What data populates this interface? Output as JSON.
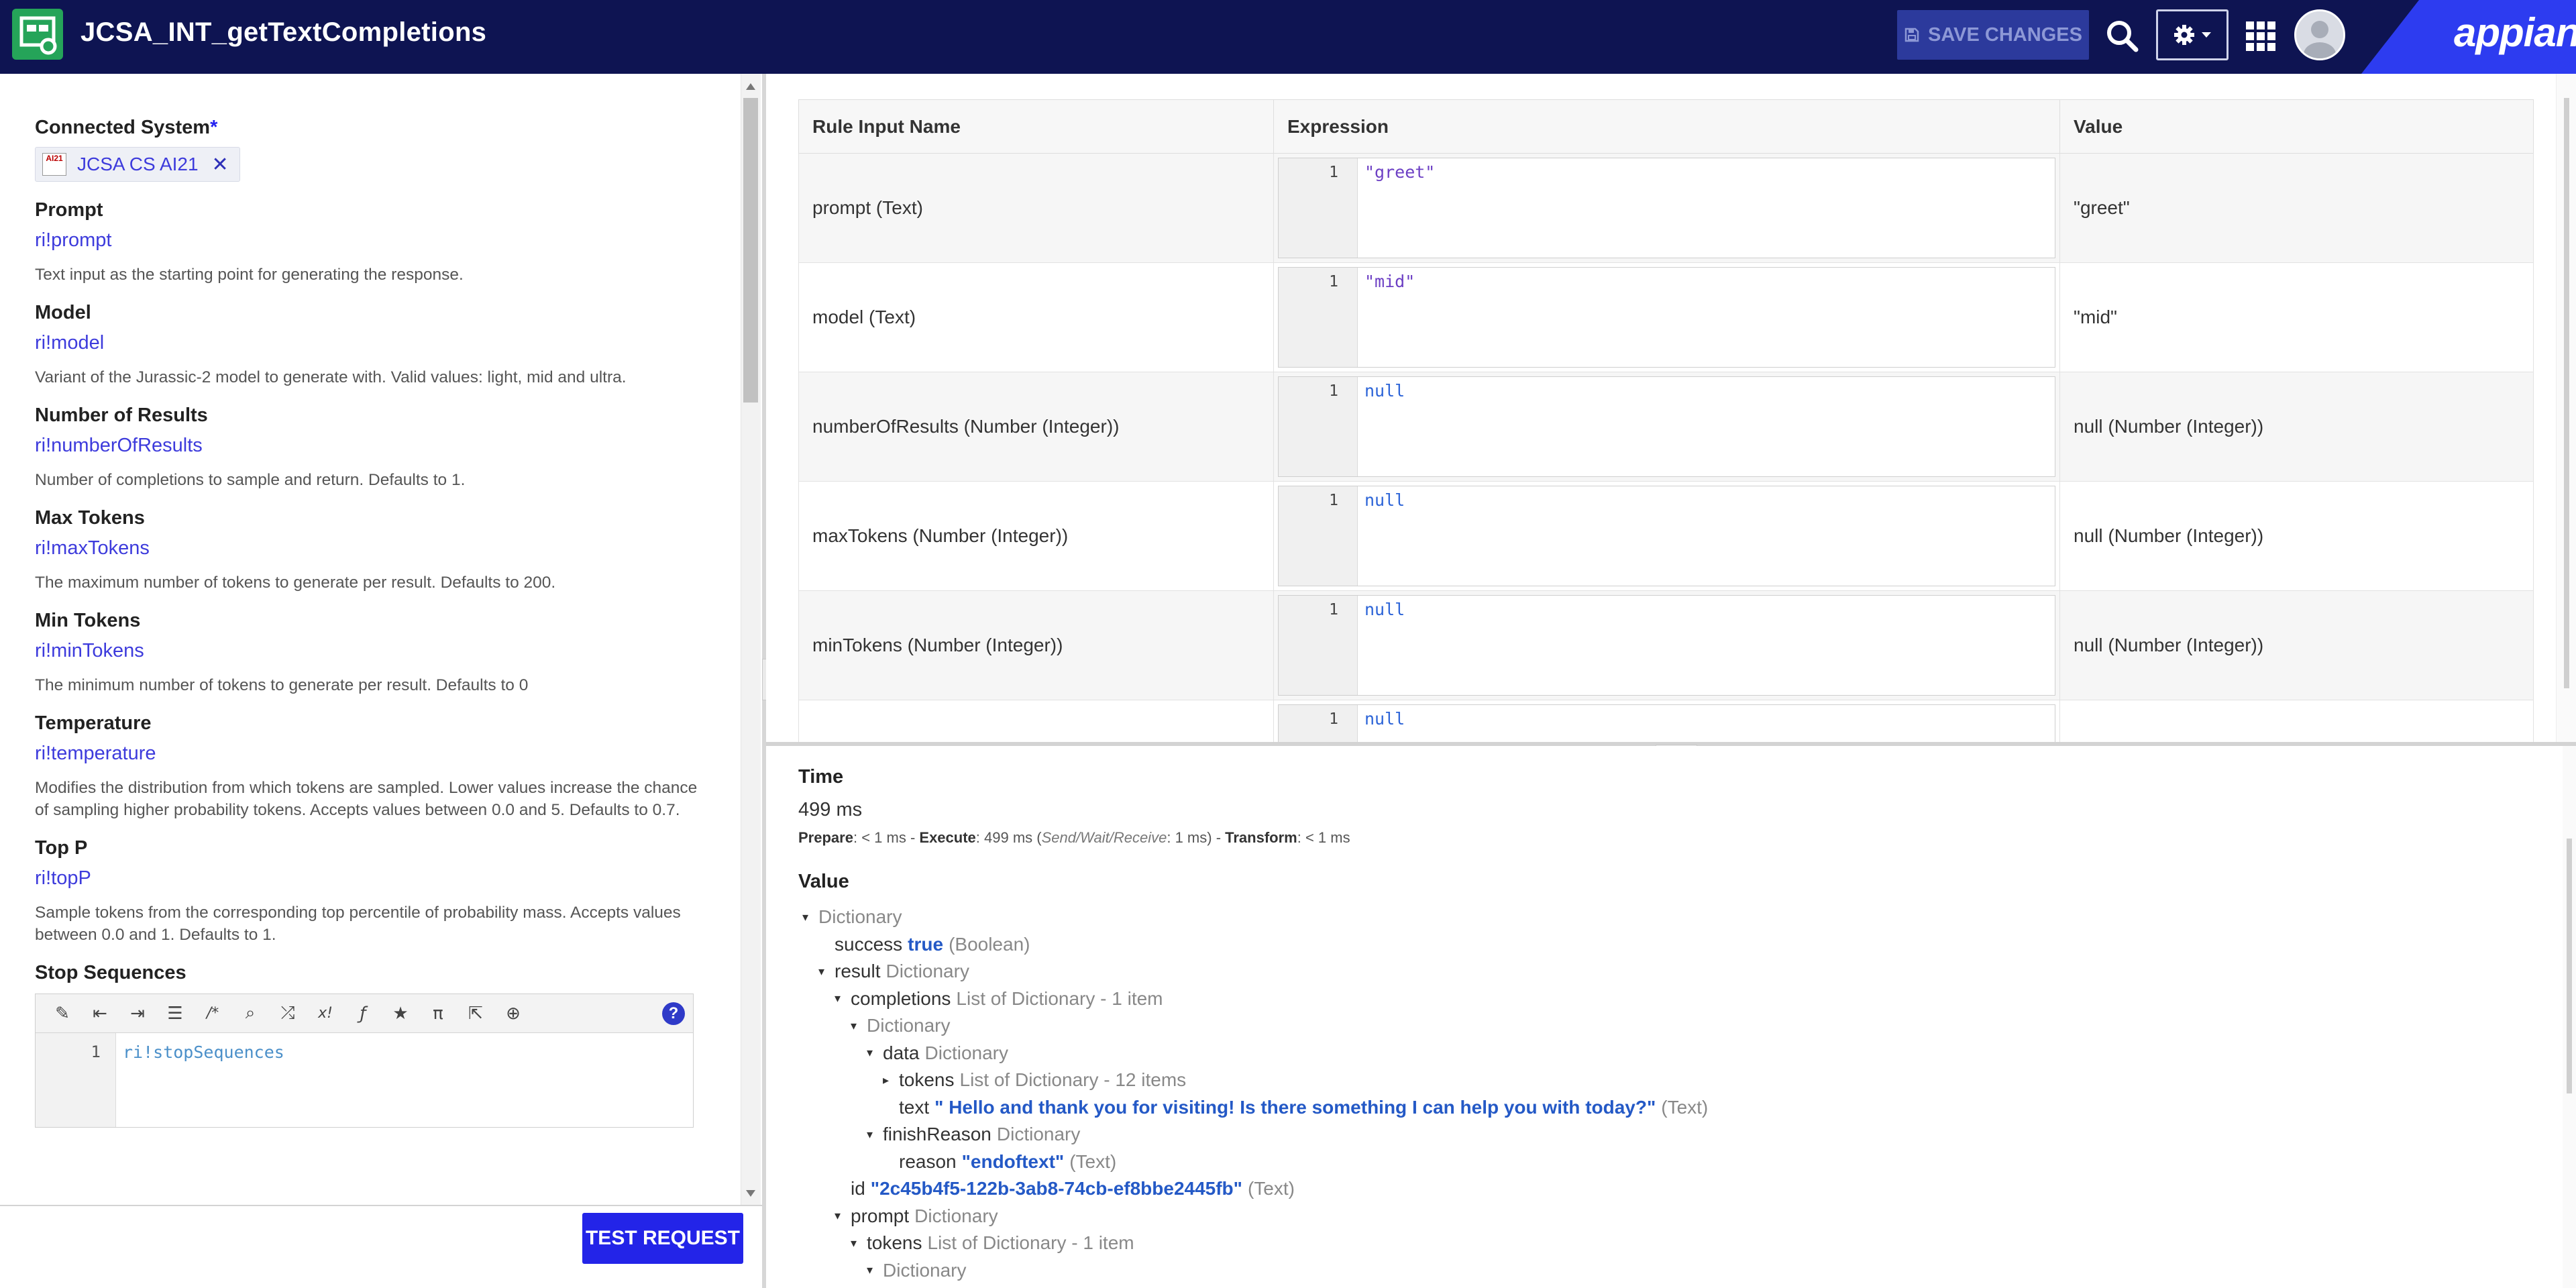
{
  "header": {
    "title": "JCSA_INT_getTextCompletions",
    "save_label": "SAVE CHANGES",
    "logo": "appian"
  },
  "left": {
    "connected_system": {
      "label": "Connected System",
      "required_mark": "*",
      "value": "JCSA CS AI21",
      "icon_text": "AI21"
    },
    "fields": [
      {
        "label": "Prompt",
        "value": "ri!prompt",
        "help": "Text input as the starting point for generating the response."
      },
      {
        "label": "Model",
        "value": "ri!model",
        "help": "Variant of the Jurassic-2 model to generate with. Valid values: light, mid and ultra."
      },
      {
        "label": "Number of Results",
        "value": "ri!numberOfResults",
        "help": "Number of completions to sample and return. Defaults to 1."
      },
      {
        "label": "Max Tokens",
        "value": "ri!maxTokens",
        "help": "The maximum number of tokens to generate per result. Defaults to 200."
      },
      {
        "label": "Min Tokens",
        "value": "ri!minTokens",
        "help": "The minimum number of tokens to generate per result. Defaults to 0"
      },
      {
        "label": "Temperature",
        "value": "ri!temperature",
        "help": "Modifies the distribution from which tokens are sampled. Lower values increase the chance of sampling higher probability tokens. Accepts values between 0.0 and 5. Defaults to 0.7."
      },
      {
        "label": "Top P",
        "value": "ri!topP",
        "help": "Sample tokens from the corresponding top percentile of probability mass. Accepts values between 0.0 and 1. Defaults to 1."
      }
    ],
    "stop_sequences": {
      "label": "Stop Sequences",
      "line_no": "1",
      "code": "ri!stopSequences"
    },
    "test_label": "TEST REQUEST"
  },
  "rule_inputs": {
    "headers": [
      "Rule Input Name",
      "Expression",
      "Value"
    ],
    "rows": [
      {
        "name": "prompt (Text)",
        "line": "1",
        "expr": "\"greet\"",
        "value": "\"greet\""
      },
      {
        "name": "model (Text)",
        "line": "1",
        "expr": "\"mid\"",
        "value": "\"mid\""
      },
      {
        "name": "numberOfResults (Number (Integer))",
        "line": "1",
        "expr": "null",
        "value": "null (Number (Integer))"
      },
      {
        "name": "maxTokens (Number (Integer))",
        "line": "1",
        "expr": "null",
        "value": "null (Number (Integer))"
      },
      {
        "name": "minTokens (Number (Integer))",
        "line": "1",
        "expr": "null",
        "value": "null (Number (Integer))"
      },
      {
        "name": "",
        "line": "1",
        "expr": "null",
        "value": ""
      }
    ]
  },
  "result": {
    "time_label": "Time",
    "time_value": "499 ms",
    "breakdown": {
      "prepare_label": "Prepare",
      "prepare": "< 1 ms",
      "execute_label": "Execute",
      "execute": "499 ms",
      "send_wait_receive": "Send/Wait/Receive",
      "swr_value": "1 ms",
      "transform_label": "Transform",
      "transform": "< 1 ms"
    },
    "value_label": "Value",
    "tree": [
      {
        "depth": 0,
        "toggle": "open",
        "key": "",
        "value": "",
        "type": "Dictionary"
      },
      {
        "depth": 1,
        "toggle": "none",
        "key": "success",
        "value": "true",
        "type": "(Boolean)"
      },
      {
        "depth": 1,
        "toggle": "open",
        "key": "result",
        "value": "",
        "type": "Dictionary"
      },
      {
        "depth": 2,
        "toggle": "open",
        "key": "completions",
        "value": "",
        "type": "List of Dictionary - 1 item"
      },
      {
        "depth": 3,
        "toggle": "open",
        "key": "",
        "value": "",
        "type": "Dictionary"
      },
      {
        "depth": 4,
        "toggle": "open",
        "key": "data",
        "value": "",
        "type": "Dictionary"
      },
      {
        "depth": 5,
        "toggle": "closed",
        "key": "tokens",
        "value": "",
        "type": "List of Dictionary - 12 items"
      },
      {
        "depth": 5,
        "toggle": "none",
        "key": "text",
        "value": "\" Hello and thank you for visiting! Is there something I can help you with today?\"",
        "type": "(Text)"
      },
      {
        "depth": 4,
        "toggle": "open",
        "key": "finishReason",
        "value": "",
        "type": "Dictionary"
      },
      {
        "depth": 5,
        "toggle": "none",
        "key": "reason",
        "value": "\"endoftext\"",
        "type": "(Text)"
      },
      {
        "depth": 2,
        "toggle": "none",
        "key": "id",
        "value": "\"2c45b4f5-122b-3ab8-74cb-ef8bbe2445fb\"",
        "type": "(Text)"
      },
      {
        "depth": 2,
        "toggle": "open",
        "key": "prompt",
        "value": "",
        "type": "Dictionary"
      },
      {
        "depth": 3,
        "toggle": "open",
        "key": "tokens",
        "value": "",
        "type": "List of Dictionary - 1 item"
      },
      {
        "depth": 4,
        "toggle": "open",
        "key": "",
        "value": "",
        "type": "Dictionary"
      }
    ]
  },
  "colors": {
    "header_bg": "#0e1452",
    "accent": "#2324e8",
    "link": "#3d3bdc",
    "value_blue": "#2459c6",
    "app_icon": "#25a459"
  },
  "icons": [
    "integration-icon",
    "save-icon",
    "search-icon",
    "gear-icon",
    "apps-grid-icon",
    "user-avatar-icon",
    "close-icon",
    "collapse-left-icon",
    "expand-up-icon"
  ]
}
